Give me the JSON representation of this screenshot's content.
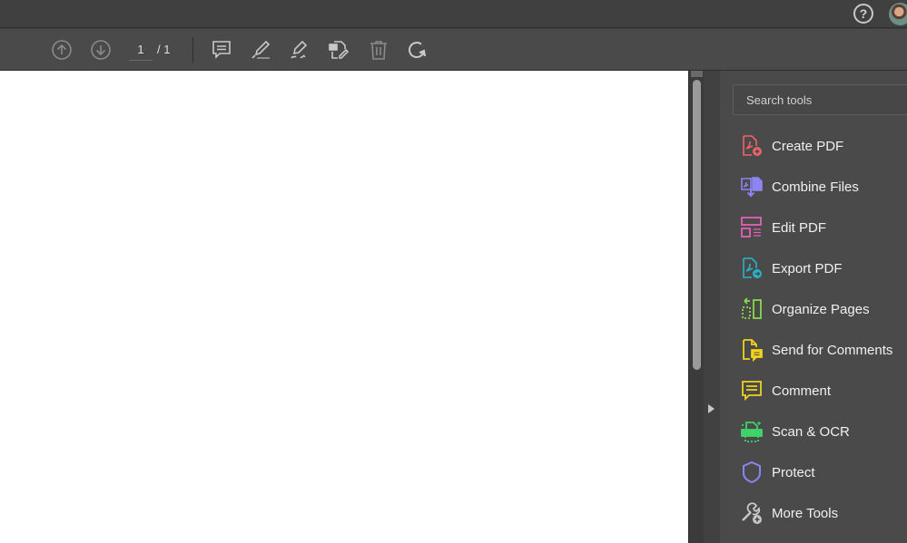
{
  "header": {
    "help_glyph": "?",
    "help_icon": "help-circle-icon",
    "avatar_icon": "user-avatar"
  },
  "toolbar": {
    "prev_page_icon": "arrow-up-circle-icon",
    "next_page_icon": "arrow-down-circle-icon",
    "current_page": "1",
    "total_pages": "/ 1",
    "tools": [
      {
        "name": "comment",
        "icon": "comment-icon"
      },
      {
        "name": "highlight",
        "icon": "highlighter-icon"
      },
      {
        "name": "sign",
        "icon": "pen-sign-icon"
      },
      {
        "name": "edit",
        "icon": "edit-document-icon"
      },
      {
        "name": "delete",
        "icon": "trash-icon"
      },
      {
        "name": "rotate",
        "icon": "rotate-icon"
      }
    ]
  },
  "tools_panel": {
    "search_placeholder": "Search tools",
    "items": [
      {
        "label": "Create PDF",
        "icon": "create-pdf-icon",
        "color": "#f0626a"
      },
      {
        "label": "Combine Files",
        "icon": "combine-files-icon",
        "color": "#8c84f0"
      },
      {
        "label": "Edit PDF",
        "icon": "edit-pdf-icon",
        "color": "#e35fb7"
      },
      {
        "label": "Export PDF",
        "icon": "export-pdf-icon",
        "color": "#28b4c8"
      },
      {
        "label": "Organize Pages",
        "icon": "organize-pages-icon",
        "color": "#8ad94a"
      },
      {
        "label": "Send for Comments",
        "icon": "send-for-comments-icon",
        "color": "#f2d21c"
      },
      {
        "label": "Comment",
        "icon": "comment-icon",
        "color": "#f2d21c"
      },
      {
        "label": "Scan & OCR",
        "icon": "scan-ocr-icon",
        "color": "#3fd46a"
      },
      {
        "label": "Protect",
        "icon": "shield-icon",
        "color": "#8c84f0"
      },
      {
        "label": "More Tools",
        "icon": "more-tools-icon",
        "color": "#c8c8c8"
      }
    ]
  }
}
